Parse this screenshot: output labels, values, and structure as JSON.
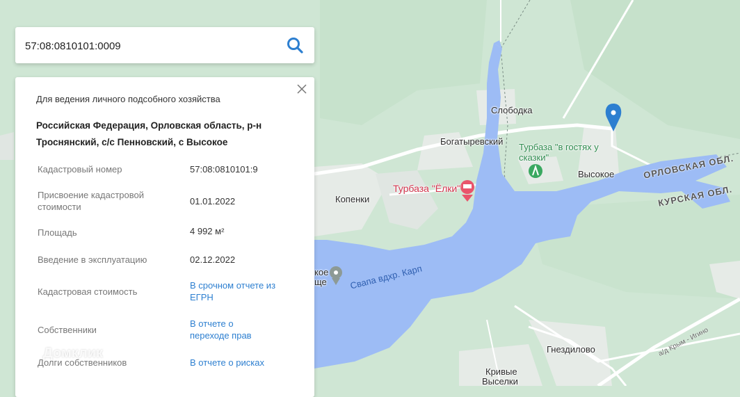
{
  "search": {
    "value": "57:08:0810101:0009",
    "icon": "search-icon"
  },
  "panel": {
    "usage": "Для ведения личного подсобного хозяйства",
    "address_line1": "Российская Федерация, Орловская область, р-н",
    "address_line2": "Троснянский, с/с Пенновский, с Высокое",
    "properties": [
      {
        "label": "Кадастровый номер",
        "value": "57:08:0810101:9",
        "link": false
      },
      {
        "label": "Присвоение кадастровой стоимости",
        "value": "01.01.2022",
        "link": false
      },
      {
        "label": "Площадь",
        "value": "4 992 м²",
        "link": false
      },
      {
        "label": "Введение в эксплуатацию",
        "value": "02.12.2022",
        "link": false
      },
      {
        "label": "Кадастровая стоимость",
        "value": "В срочном отчете из ЕГРН",
        "link": true
      },
      {
        "label": "Собственники",
        "value": "В отчете о переходе прав",
        "link": true
      },
      {
        "label": "Долги собственников",
        "value": "В отчете о рисках",
        "link": true
      }
    ]
  },
  "map": {
    "labels": {
      "slobodka": "Слободка",
      "bogatyrevsky": "Богатыревский",
      "turbaza_skazki": "Турбаза \"в гостях у сказки\"",
      "vysokoe": "Высокое",
      "kopenki": "Копенки",
      "turbaza_elki": "Турбаза \"Ёлки\"",
      "svapa": "Свапа вдхр. Карп",
      "gnezdilovo": "Гнездилово",
      "krivye": "Кривые",
      "vyselki": "Выселки",
      "orel_obl": "ОРЛОВСКАЯ ОБЛ.",
      "kursk_obl": "КУРСКАЯ ОБЛ.",
      "road": "а/д Крым - Игино",
      "partial_place_1": "кое",
      "partial_place_2": "ще"
    },
    "colors": {
      "land": "#cfe6d4",
      "water": "#9dbcf5",
      "road": "#ffffff",
      "settlement": "#e8ece9",
      "marker": "#2d7fd0"
    }
  },
  "watermark": "Домклик"
}
